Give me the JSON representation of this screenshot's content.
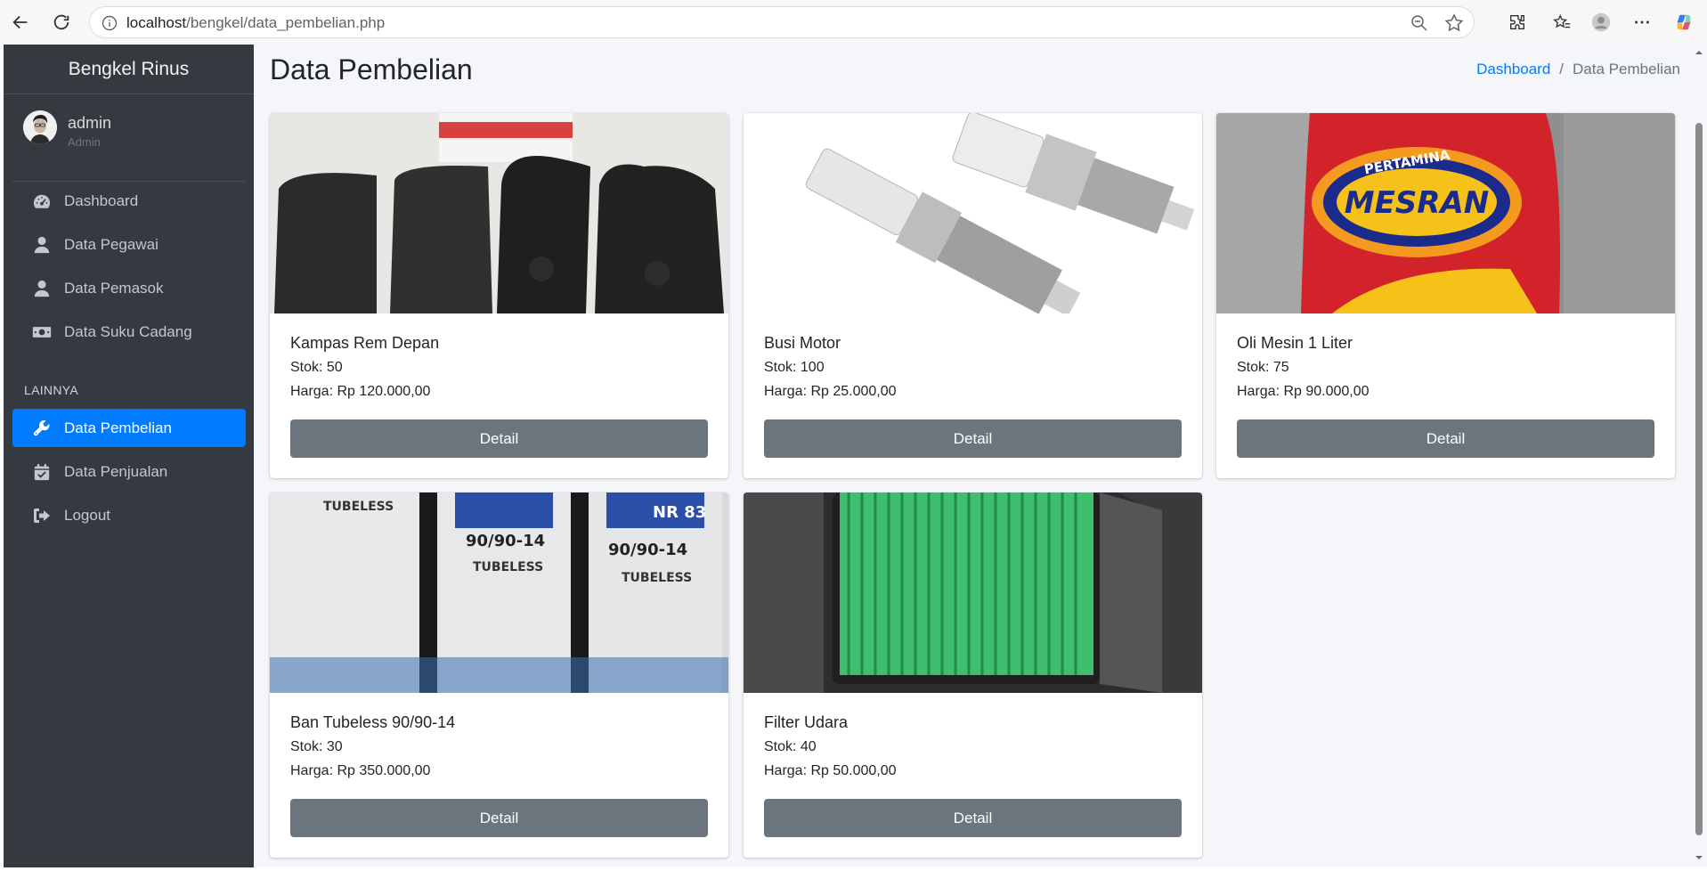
{
  "browser": {
    "url_host": "localhost",
    "url_path": "/bengkel/data_pembelian.php"
  },
  "sidebar": {
    "brand": "Bengkel Rinus",
    "user": {
      "name": "admin",
      "role": "Admin"
    },
    "items": [
      {
        "label": "Dashboard",
        "icon": "tachometer-icon"
      },
      {
        "label": "Data Pegawai",
        "icon": "user-icon"
      },
      {
        "label": "Data Pemasok",
        "icon": "user-icon"
      },
      {
        "label": "Data Suku Cadang",
        "icon": "money-bill-icon"
      }
    ],
    "section_header": "LAINNYA",
    "items_other": [
      {
        "label": "Data Pembelian",
        "icon": "wrench-icon",
        "active": true
      },
      {
        "label": "Data Penjualan",
        "icon": "calendar-check-icon"
      },
      {
        "label": "Logout",
        "icon": "sign-out-icon"
      }
    ]
  },
  "main": {
    "title": "Data Pembelian",
    "breadcrumb": {
      "link": "Dashboard",
      "separator": "/",
      "current": "Data Pembelian"
    },
    "products": [
      {
        "name": "Kampas Rem Depan",
        "stock": "Stok: 50",
        "price": "Harga: Rp 120.000,00",
        "button": "Detail",
        "image": "brake-pads-photo"
      },
      {
        "name": "Busi Motor",
        "stock": "Stok: 100",
        "price": "Harga: Rp 25.000,00",
        "button": "Detail",
        "image": "spark-plug-photo"
      },
      {
        "name": "Oli Mesin 1 Liter",
        "stock": "Stok: 75",
        "price": "Harga: Rp 90.000,00",
        "button": "Detail",
        "image": "engine-oil-photo",
        "image_text": [
          "PERTAMINA",
          "MESRAN"
        ]
      },
      {
        "name": "Ban Tubeless 90/90-14",
        "stock": "Stok: 30",
        "price": "Harga: Rp 350.000,00",
        "button": "Detail",
        "image": "tubeless-tires-photo",
        "image_text": [
          "TUBELESS",
          "90/90-14",
          "NR 83"
        ]
      },
      {
        "name": "Filter Udara",
        "stock": "Stok: 40",
        "price": "Harga: Rp 50.000,00",
        "button": "Detail",
        "image": "air-filter-photo"
      }
    ]
  },
  "colors": {
    "sidebar_bg": "#343a40",
    "active_nav": "#007bff",
    "button_bg": "#6c757d",
    "content_bg": "#f4f6f9",
    "link": "#007bff"
  }
}
